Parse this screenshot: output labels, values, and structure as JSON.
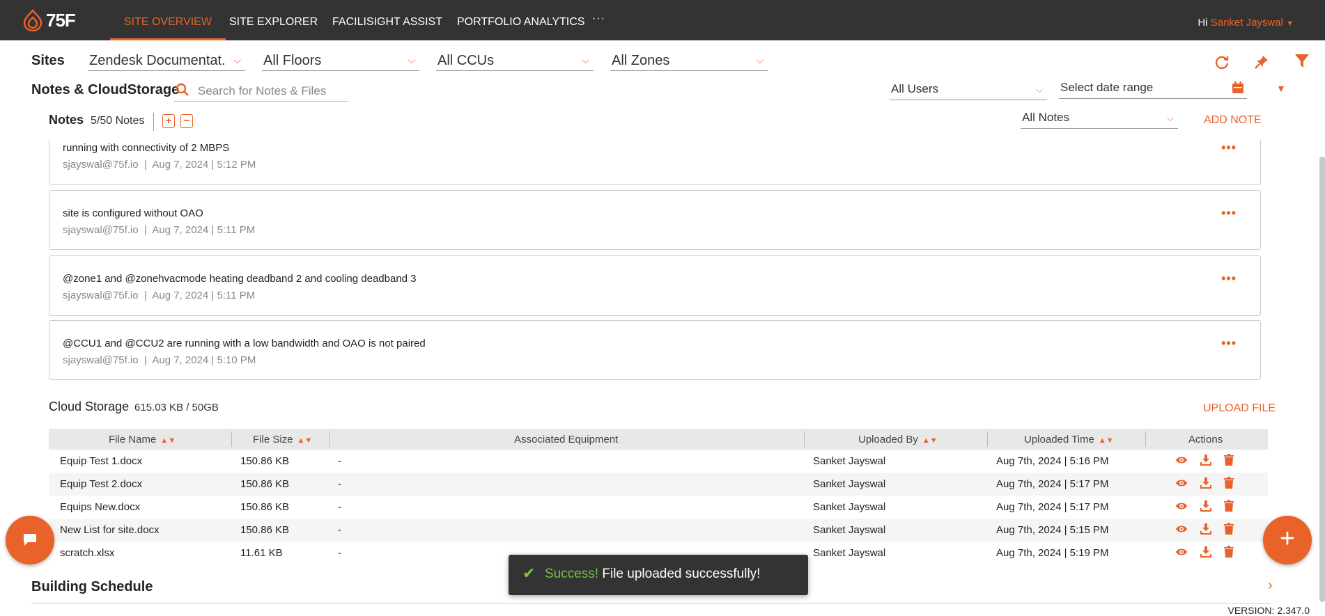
{
  "header": {
    "logo_text": "75F",
    "nav": [
      "SITE OVERVIEW",
      "SITE EXPLORER",
      "FACILISIGHT ASSIST",
      "PORTFOLIO ANALYTICS"
    ],
    "more": "···",
    "greeting": "Hi",
    "user": "Sanket Jayswal"
  },
  "sites": {
    "label": "Sites",
    "site": "Zendesk Documentat...",
    "floors": "All Floors",
    "ccus": "All CCUs",
    "zones": "All Zones"
  },
  "notes_cloud": {
    "title": "Notes & CloudStorage",
    "search_placeholder": "Search for Notes & Files",
    "users_filter": "All Users",
    "date_filter": "Select date range"
  },
  "notes": {
    "title": "Notes",
    "count": "5/50 Notes",
    "plus": "+",
    "minus": "−",
    "filter": "All Notes",
    "add_label": "ADD NOTE",
    "items": [
      {
        "text": "running with connectivity of 2 MBPS",
        "author": "sjayswal@75f.io",
        "time": "Aug 7, 2024 | 5:12 PM"
      },
      {
        "text": "site is configured without OAO",
        "author": "sjayswal@75f.io",
        "time": "Aug 7, 2024 | 5:11 PM"
      },
      {
        "text": "@zone1 and @zonehvacmode heating deadband 2 and cooling deadband 3",
        "author": "sjayswal@75f.io",
        "time": "Aug 7, 2024 | 5:11 PM"
      },
      {
        "text": "@CCU1 and @CCU2 are running with a low bandwidth and OAO is not paired",
        "author": "sjayswal@75f.io",
        "time": "Aug 7, 2024 | 5:10 PM"
      }
    ]
  },
  "cloud_storage": {
    "title": "Cloud Storage",
    "usage": "615.03 KB / 50GB",
    "upload_label": "UPLOAD FILE",
    "columns": [
      "File Name",
      "File Size",
      "Associated Equipment",
      "Uploaded By",
      "Uploaded Time",
      "Actions"
    ],
    "rows": [
      {
        "name": "Equip Test 1.docx",
        "size": "150.86 KB",
        "equipment": "-",
        "by": "Sanket Jayswal",
        "time": "Aug 7th, 2024 | 5:16 PM"
      },
      {
        "name": "Equip Test 2.docx",
        "size": "150.86 KB",
        "equipment": "-",
        "by": "Sanket Jayswal",
        "time": "Aug 7th, 2024 | 5:17 PM"
      },
      {
        "name": "Equips New.docx",
        "size": "150.86 KB",
        "equipment": "-",
        "by": "Sanket Jayswal",
        "time": "Aug 7th, 2024 | 5:17 PM"
      },
      {
        "name": "New List for site.docx",
        "size": "150.86 KB",
        "equipment": "-",
        "by": "Sanket Jayswal",
        "time": "Aug 7th, 2024 | 5:15 PM"
      },
      {
        "name": "scratch.xlsx",
        "size": "11.61 KB",
        "equipment": "-",
        "by": "Sanket Jayswal",
        "time": "Aug 7th, 2024 | 5:19 PM"
      }
    ]
  },
  "building_schedule": {
    "title": "Building Schedule"
  },
  "toast": {
    "success": "Success!",
    "message": "File uploaded successfully!"
  },
  "version": "VERSION: 2.347.0",
  "colors": {
    "accent": "#e8622a",
    "topbar": "#333333",
    "success": "#7ac142"
  }
}
